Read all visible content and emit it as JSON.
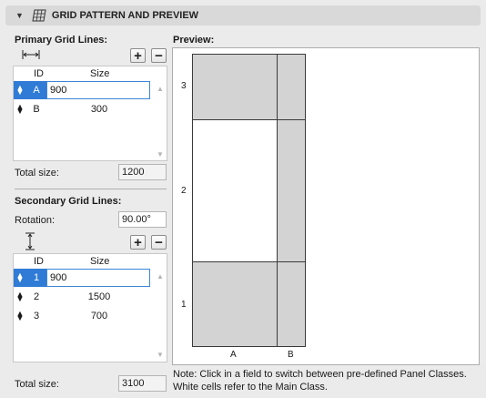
{
  "header": {
    "title": "GRID PATTERN AND PREVIEW"
  },
  "primary": {
    "title": "Primary Grid Lines:",
    "columns": {
      "id": "ID",
      "size": "Size"
    },
    "rows": [
      {
        "id": "A",
        "size": "900",
        "selected": true
      },
      {
        "id": "B",
        "size": "300",
        "selected": false
      }
    ],
    "total_label": "Total size:",
    "total_value": "1200",
    "add_label": "+",
    "remove_label": "−"
  },
  "secondary": {
    "title": "Secondary Grid Lines:",
    "rotation_label": "Rotation:",
    "rotation_value": "90.00°",
    "columns": {
      "id": "ID",
      "size": "Size"
    },
    "rows": [
      {
        "id": "1",
        "size": "900",
        "selected": true
      },
      {
        "id": "2",
        "size": "1500",
        "selected": false
      },
      {
        "id": "3",
        "size": "700",
        "selected": false
      }
    ],
    "total_label": "Total size:",
    "total_value": "3100",
    "add_label": "+",
    "remove_label": "−"
  },
  "preview": {
    "title": "Preview:",
    "column_labels": [
      "A",
      "B"
    ],
    "row_labels": [
      "3",
      "2",
      "1"
    ],
    "cells": [
      {
        "row": "3",
        "col": "A",
        "fill": "gray"
      },
      {
        "row": "3",
        "col": "B",
        "fill": "gray"
      },
      {
        "row": "2",
        "col": "A",
        "fill": "white"
      },
      {
        "row": "2",
        "col": "B",
        "fill": "gray"
      },
      {
        "row": "1",
        "col": "A",
        "fill": "gray"
      },
      {
        "row": "1",
        "col": "B",
        "fill": "gray"
      }
    ],
    "note_line1": "Note: Click in a field to switch between pre-defined Panel Classes.",
    "note_line2": "White cells refer to the Main Class."
  },
  "colors": {
    "selection": "#2f7bd6",
    "cell_gray": "#d3d3d3",
    "cell_white": "#ffffff"
  }
}
